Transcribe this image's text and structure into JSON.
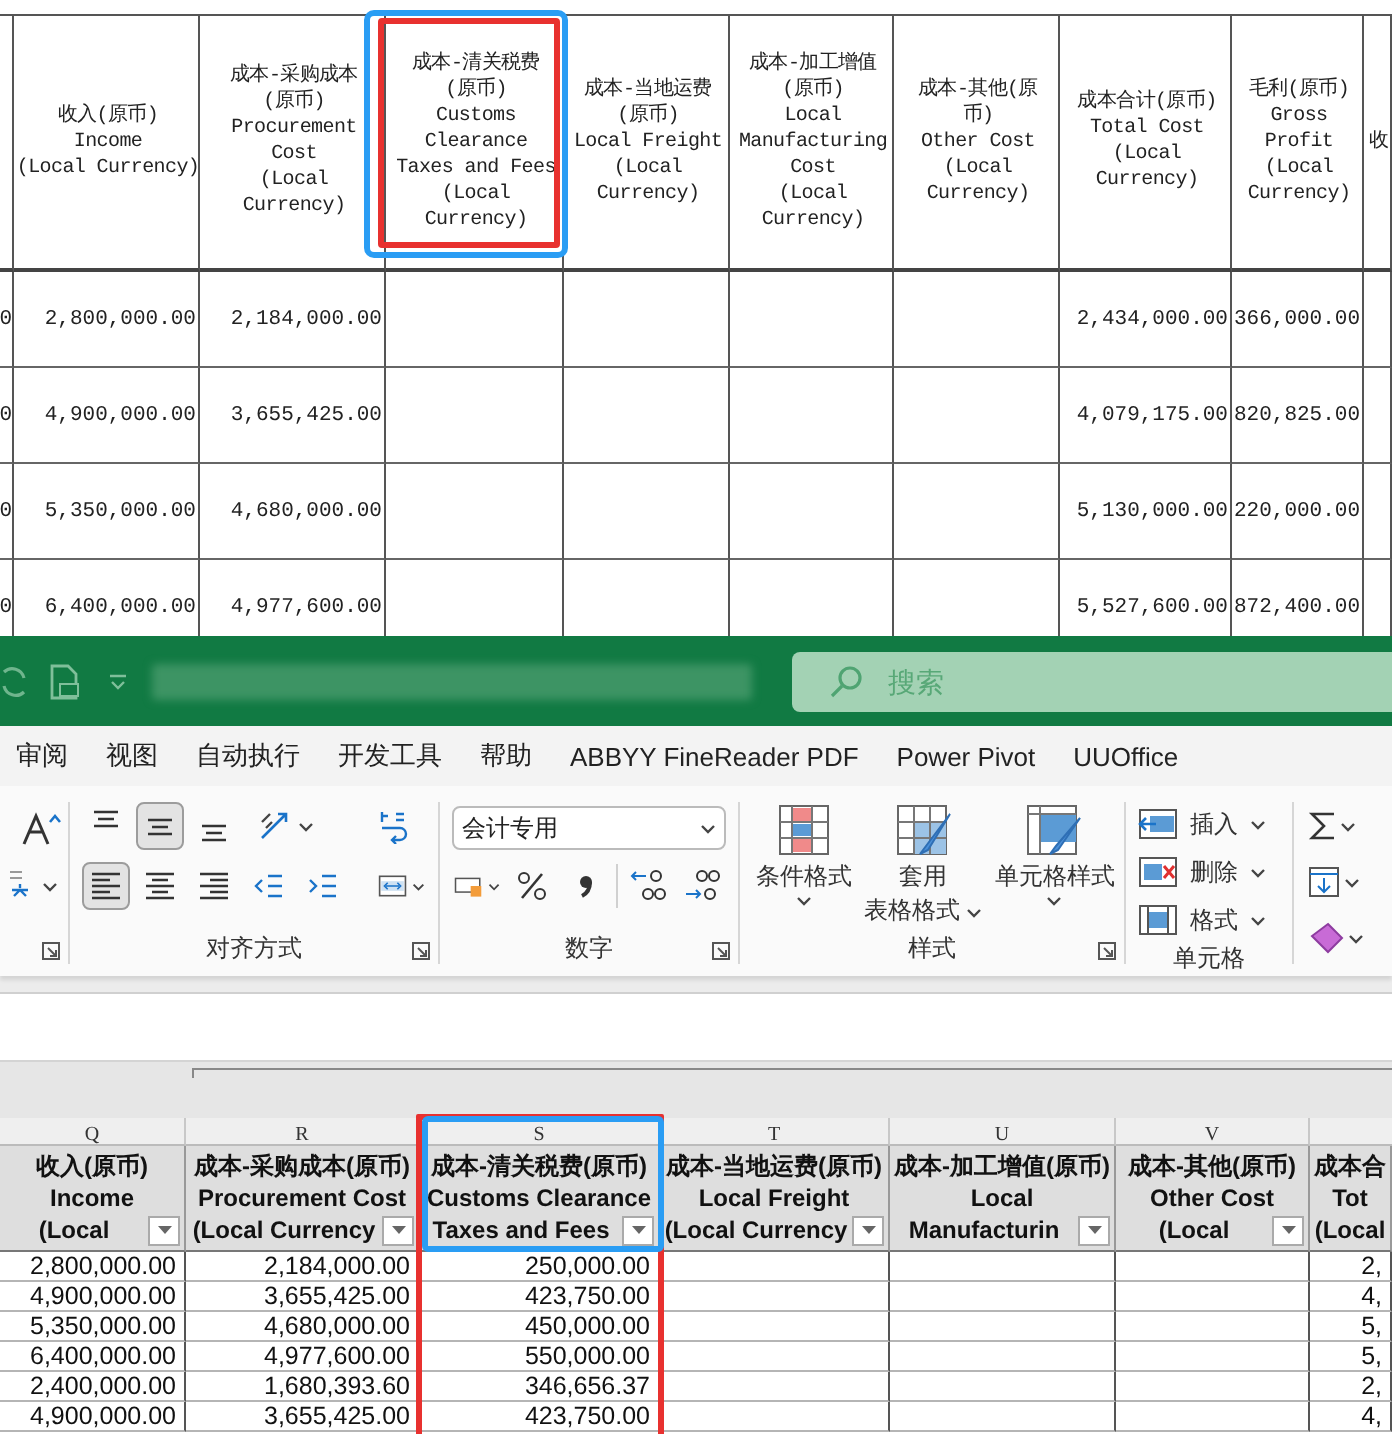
{
  "print_table": {
    "columns": [
      {
        "header": [
          "收入(原币)",
          "Income",
          "(Local Currency)"
        ]
      },
      {
        "header": [
          "成本-采购成本",
          "(原币)",
          "Procurement",
          "Cost",
          "(Local",
          "Currency)"
        ]
      },
      {
        "header": [
          "成本-清关税费",
          "(原币)",
          "Customs",
          "Clearance",
          "Taxes and Fees",
          "(Local",
          "Currency)"
        ]
      },
      {
        "header": [
          "成本-当地运费",
          "(原币)",
          "Local Freight",
          "(Local",
          "Currency)"
        ]
      },
      {
        "header": [
          "成本-加工增值",
          "(原币)",
          "Local",
          "Manufacturing",
          "Cost",
          "(Local",
          "Currency)"
        ]
      },
      {
        "header": [
          "成本-其他(原",
          "币)",
          "Other Cost",
          "(Local",
          "Currency)"
        ]
      },
      {
        "header": [
          "成本合计(原币)",
          "Total Cost",
          "(Local",
          "Currency)"
        ]
      },
      {
        "header": [
          "毛利(原币)",
          "Gross",
          "Profit",
          "(Local",
          "Currency)"
        ]
      },
      {
        "header": [
          "收"
        ]
      }
    ],
    "rows": [
      {
        "cut_cell": "0",
        "cells": [
          "2,800,000.00",
          "2,184,000.00",
          null,
          null,
          null,
          null,
          "2,434,000.00",
          "366,000.00",
          null
        ]
      },
      {
        "cut_cell": "0",
        "cells": [
          "4,900,000.00",
          "3,655,425.00",
          null,
          null,
          null,
          null,
          "4,079,175.00",
          "820,825.00",
          null
        ]
      },
      {
        "cut_cell": "0",
        "cells": [
          "5,350,000.00",
          "4,680,000.00",
          null,
          null,
          null,
          null,
          "5,130,000.00",
          "220,000.00",
          null
        ]
      },
      {
        "cut_cell": "0",
        "cells": [
          "6,400,000.00",
          "4,977,600.00",
          null,
          null,
          null,
          null,
          "5,527,600.00",
          "872,400.00",
          null
        ]
      }
    ]
  },
  "title_bar": {
    "search": {
      "placeholder": "搜索"
    }
  },
  "ribbon_tabs": [
    {
      "label": "审阅"
    },
    {
      "label": "视图"
    },
    {
      "label": "自动执行"
    },
    {
      "label": "开发工具"
    },
    {
      "label": "帮助"
    },
    {
      "label": "ABBYY FineReader PDF"
    },
    {
      "label": "Power Pivot"
    },
    {
      "label": "UUOffice"
    }
  ],
  "ribbon": {
    "alignment": {
      "label": "对齐方式",
      "vertical": [
        {
          "kind": "top",
          "selected": false
        },
        {
          "kind": "middle",
          "selected": true
        },
        {
          "kind": "bottom",
          "selected": false
        }
      ],
      "horizontal": [
        {
          "kind": "left",
          "selected": true
        },
        {
          "kind": "center",
          "selected": false
        },
        {
          "kind": "right",
          "selected": false
        }
      ]
    },
    "number": {
      "label": "数字",
      "format": "会计专用"
    },
    "styles": {
      "label": "样式",
      "buttons": [
        {
          "kind": "conditional",
          "lines": [
            "条件格式"
          ]
        },
        {
          "kind": "table",
          "lines": [
            "套用",
            "表格格式"
          ]
        },
        {
          "kind": "cell",
          "lines": [
            "单元格样式"
          ]
        }
      ]
    },
    "cells": {
      "label": "单元格",
      "buttons": [
        {
          "kind": "insert",
          "label": "插入"
        },
        {
          "kind": "delete",
          "label": "删除"
        },
        {
          "kind": "format",
          "label": "格式"
        }
      ]
    }
  },
  "sheet": {
    "columns": [
      {
        "letter": "Q",
        "header": [
          "收入(原币)",
          "Income",
          "(Local"
        ],
        "filter": true
      },
      {
        "letter": "R",
        "header": [
          "成本-采购成本(原币)",
          "Procurement Cost",
          "(Local Currency"
        ],
        "filter": true
      },
      {
        "letter": "S",
        "header": [
          "成本-清关税费(原币)",
          "Customs Clearance",
          "Taxes and Fees"
        ],
        "filter": true
      },
      {
        "letter": "T",
        "header": [
          "成本-当地运费(原币)",
          "Local Freight",
          "(Local Currency"
        ],
        "filter": true
      },
      {
        "letter": "U",
        "header": [
          "成本-加工增值(原币)",
          "Local",
          "Manufacturin"
        ],
        "filter": true
      },
      {
        "letter": "V",
        "header": [
          "成本-其他(原币)",
          "Other Cost",
          "(Local"
        ],
        "filter": true
      },
      {
        "header": [
          "成本合",
          "Tot",
          "(Local"
        ],
        "filter": false
      }
    ],
    "rows": [
      [
        "2,800,000.00",
        "2,184,000.00",
        "250,000.00",
        null,
        null,
        null,
        "2,"
      ],
      [
        "4,900,000.00",
        "3,655,425.00",
        "423,750.00",
        null,
        null,
        null,
        "4,"
      ],
      [
        "5,350,000.00",
        "4,680,000.00",
        "450,000.00",
        null,
        null,
        null,
        "5,"
      ],
      [
        "6,400,000.00",
        "4,977,600.00",
        "550,000.00",
        null,
        null,
        null,
        "5,"
      ],
      [
        "2,400,000.00",
        "1,680,393.60",
        "346,656.37",
        null,
        null,
        null,
        "2,"
      ],
      [
        "4,900,000.00",
        "3,655,425.00",
        "423,750.00",
        null,
        null,
        null,
        "4,"
      ]
    ]
  }
}
